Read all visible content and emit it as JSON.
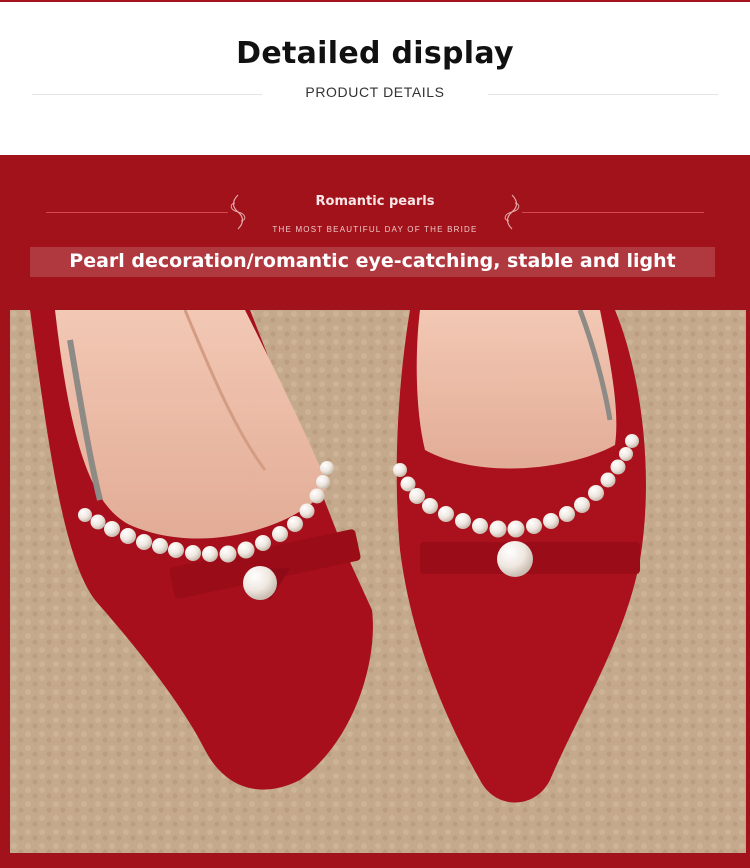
{
  "header": {
    "title": "Detailed display",
    "subtitle": "PRODUCT DETAILS"
  },
  "banner": {
    "title": "Romantic pearls",
    "subtitle": "THE MOST BEAUTIFUL DAY OF THE BRIDE",
    "feature": "Pearl decoration/romantic eye-catching, stable and light"
  },
  "colors": {
    "accent_red": "#a1121b",
    "shoe_red": "#b0101e"
  },
  "photo": {
    "subject": "product-photo-red-pearl-pumps"
  }
}
